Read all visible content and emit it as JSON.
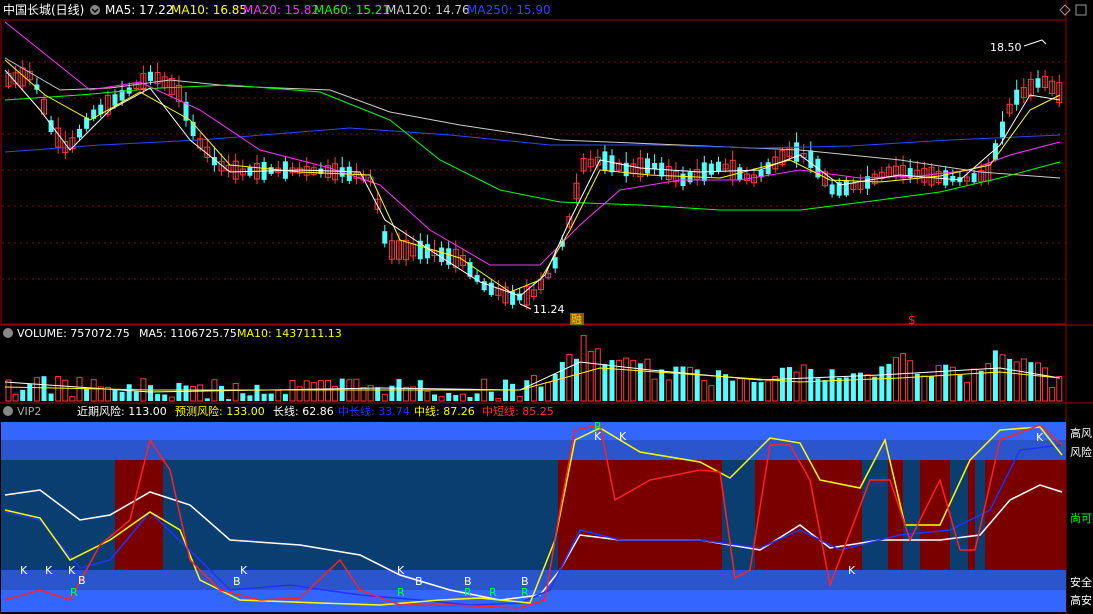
{
  "main": {
    "title": "中国长城(日线)",
    "ma": [
      {
        "label": "MA5: 17.22",
        "color": "#ffffff"
      },
      {
        "label": "MA10: 16.85",
        "color": "#ffff00"
      },
      {
        "label": "MA20: 15.82",
        "color": "#ff33ff"
      },
      {
        "label": "MA60: 15.21",
        "color": "#00ff00"
      },
      {
        "label": "MA120: 14.76",
        "color": "#cccccc"
      },
      {
        "label": "MA250: 15.90",
        "color": "#3344ff"
      }
    ],
    "high_label": "18.50",
    "low_label": "11.24",
    "marker_1": "融",
    "marker_2": "$"
  },
  "volume": {
    "title": "VOLUME: 757072.75",
    "ma5": "MA5: 1106725.75",
    "ma10": "MA10: 1437111.13"
  },
  "vip": {
    "title": "VIP2",
    "legend": [
      {
        "label": "近期风险: 113.00",
        "color": "#ffffff"
      },
      {
        "label": "预测风险: 133.00",
        "color": "#ffff00"
      },
      {
        "label": "长线: 62.86",
        "color": "#ffffff"
      },
      {
        "label": "中长线: 33.74",
        "color": "#2233ff"
      },
      {
        "label": "中线: 87.26",
        "color": "#ffff00"
      },
      {
        "label": "中短线: 85.25",
        "color": "#ff3333"
      }
    ],
    "right_labels": [
      "高风",
      "风险",
      "尚可持",
      "安全",
      "高安"
    ],
    "signals": [
      "K",
      "K",
      "K",
      "B",
      "R",
      "B",
      "K",
      "K",
      "B",
      "R",
      "B",
      "R",
      "R",
      "B",
      "R",
      "R",
      "K",
      "K",
      "K"
    ]
  },
  "chart_data": {
    "type": "line",
    "title": "中国长城(日线)",
    "ylim": [
      11.24,
      18.5
    ],
    "series": [
      {
        "name": "MA5",
        "values": [
          17.22
        ]
      },
      {
        "name": "MA10",
        "values": [
          16.85
        ]
      },
      {
        "name": "MA20",
        "values": [
          15.82
        ]
      },
      {
        "name": "MA60",
        "values": [
          15.21
        ]
      },
      {
        "name": "MA120",
        "values": [
          14.76
        ]
      },
      {
        "name": "MA250",
        "values": [
          15.9
        ]
      }
    ],
    "annotations": [
      "18.50",
      "11.24"
    ],
    "volume": {
      "VOLUME": 757072.75,
      "MA5": 1106725.75,
      "MA10": 1437111.13
    },
    "indicator": {
      "近期风险": 113.0,
      "预测风险": 133.0,
      "长线": 62.86,
      "中长线": 33.74,
      "中线": 87.26,
      "中短线": 85.25
    }
  }
}
